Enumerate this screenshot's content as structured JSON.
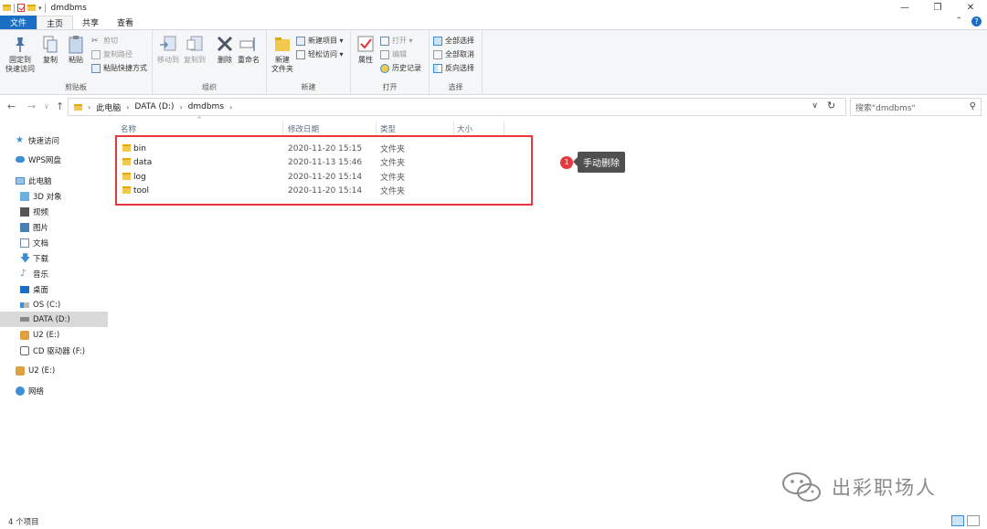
{
  "window": {
    "title": "dmdbms",
    "controls": [
      "minimize-icon",
      "maximize-icon",
      "close-icon"
    ]
  },
  "ribbon_tabs": [
    "文件",
    "主页",
    "共享",
    "查看"
  ],
  "ribbon": {
    "clipboard": {
      "pin": "固定到\n快速访问",
      "copy": "复制",
      "paste": "粘贴",
      "cut": "剪切",
      "copy_path": "复制路径",
      "paste_shortcut": "粘贴快捷方式",
      "label": "剪贴板"
    },
    "organize": {
      "move_to": "移动到",
      "copy_to": "复制到",
      "delete": "删除",
      "rename": "重命名",
      "label": "组织"
    },
    "new": {
      "new_folder": "新建\n文件夹",
      "new_item": "新建项目 ▾",
      "easy_access": "轻松访问 ▾",
      "label": "新建"
    },
    "open": {
      "properties": "属性",
      "open": "打开 ▾",
      "edit": "编辑",
      "history": "历史记录",
      "label": "打开"
    },
    "select": {
      "select_all": "全部选择",
      "select_none": "全部取消",
      "invert": "反向选择",
      "label": "选择"
    }
  },
  "address": {
    "crumbs": [
      "此电脑",
      "DATA (D:)",
      "dmdbms"
    ],
    "search_placeholder": "搜索\"dmdbms\""
  },
  "nav_pane": [
    {
      "label": "快速访问",
      "icon": "star-icon"
    },
    {
      "label": "WPS网盘",
      "icon": "cloud-icon"
    },
    {
      "label": "此电脑",
      "icon": "computer-icon"
    },
    {
      "label": "3D 对象",
      "icon": "cube-icon"
    },
    {
      "label": "视频",
      "icon": "video-icon"
    },
    {
      "label": "图片",
      "icon": "picture-icon"
    },
    {
      "label": "文档",
      "icon": "document-icon"
    },
    {
      "label": "下载",
      "icon": "download-icon"
    },
    {
      "label": "音乐",
      "icon": "music-icon"
    },
    {
      "label": "桌面",
      "icon": "desktop-icon"
    },
    {
      "label": "OS (C:)",
      "icon": "drive-icon"
    },
    {
      "label": "DATA (D:)",
      "icon": "drive-icon",
      "selected": true
    },
    {
      "label": "U2 (E:)",
      "icon": "usb-drive-icon"
    },
    {
      "label": "CD 驱动器 (F:)",
      "icon": "cd-drive-icon"
    },
    {
      "label": "U2 (E:)",
      "icon": "usb-drive-icon"
    },
    {
      "label": "网络",
      "icon": "network-icon"
    }
  ],
  "columns": [
    "名称",
    "修改日期",
    "类型",
    "大小"
  ],
  "files": [
    {
      "name": "bin",
      "date": "2020-11-20 15:15",
      "type": "文件夹",
      "size": ""
    },
    {
      "name": "data",
      "date": "2020-11-13 15:46",
      "type": "文件夹",
      "size": ""
    },
    {
      "name": "log",
      "date": "2020-11-20 15:14",
      "type": "文件夹",
      "size": ""
    },
    {
      "name": "tool",
      "date": "2020-11-20 15:14",
      "type": "文件夹",
      "size": ""
    }
  ],
  "annotation": {
    "number": "1",
    "label": "手动删除"
  },
  "watermark": "出彩职场人",
  "status": "4 个项目",
  "colors": {
    "accent": "#1a6fc4",
    "highlight": "#e8383d",
    "folder": "#f2c94c"
  }
}
